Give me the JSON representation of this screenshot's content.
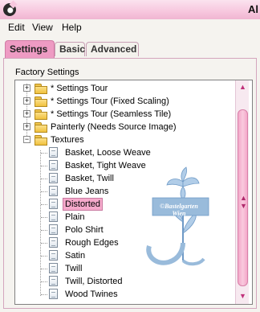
{
  "title": "Al",
  "menu": [
    "Edit",
    "View",
    "Help"
  ],
  "tabs": [
    {
      "label": "Settings",
      "active": true
    },
    {
      "label": "Basic",
      "active": false
    },
    {
      "label": "Advanced",
      "active": false
    }
  ],
  "group_label": "Factory Settings",
  "tree": {
    "folders": [
      {
        "label": "* Settings Tour",
        "expanded": false
      },
      {
        "label": "* Settings Tour (Fixed Scaling)",
        "expanded": false
      },
      {
        "label": "* Settings Tour (Seamless Tile)",
        "expanded": false
      },
      {
        "label": "Painterly (Needs Source Image)",
        "expanded": false
      },
      {
        "label": "Textures",
        "expanded": true
      }
    ],
    "items": [
      {
        "label": "Basket, Loose Weave",
        "selected": false
      },
      {
        "label": "Basket, Tight Weave",
        "selected": false
      },
      {
        "label": "Basket, Twill",
        "selected": false
      },
      {
        "label": "Blue Jeans",
        "selected": false
      },
      {
        "label": "Distorted",
        "selected": true
      },
      {
        "label": "Plain",
        "selected": false
      },
      {
        "label": "Polo Shirt",
        "selected": false
      },
      {
        "label": "Rough Edges",
        "selected": false
      },
      {
        "label": "Satin",
        "selected": false
      },
      {
        "label": "Twill",
        "selected": false
      },
      {
        "label": "Twill, Distorted",
        "selected": false
      },
      {
        "label": "Wood Twines",
        "selected": false
      }
    ]
  },
  "icons": {
    "expand": "plus-box-icon",
    "collapse": "minus-box-icon",
    "folder": "folder-icon",
    "item": "document-icon"
  },
  "watermark": {
    "line1": "©Bastelgarten",
    "line2": "Wien"
  },
  "colors": {
    "accent": "#ee9bc3",
    "selection": "#f5a9cb",
    "scroll_arrow": "#c0307a",
    "watermark": "#8fb4d8"
  }
}
